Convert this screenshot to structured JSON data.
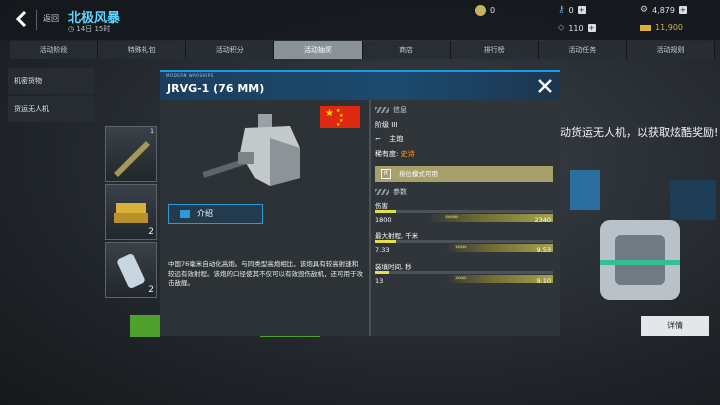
{
  "header": {
    "back_label": "返回",
    "event_title": "北极风暴",
    "event_timer": "14日 15时"
  },
  "resources": {
    "tokens": "0",
    "keys": "4,879",
    "fuel": "110",
    "gold": "11,900"
  },
  "tabs": [
    "活动阶段",
    "特殊礼包",
    "活动积分",
    "活动抽奖",
    "商店",
    "排行榜",
    "活动任务",
    "活动规则"
  ],
  "active_tab": "活动抽奖",
  "sidebar": {
    "items": [
      "机密货物",
      "货运无人机"
    ]
  },
  "background": {
    "promo_text": "动货运无人机，以获取炫酷奖励!",
    "details_button": "详情",
    "thumb_counts": [
      "1",
      "2",
      "2"
    ]
  },
  "modal": {
    "tag": "MODERN WARSHIPS",
    "title": "JRVG-1 (76 MM)",
    "intro_button": "介绍",
    "description": "中国76毫米自动化高炮。与同类型高炮相比，该炮具有较高射速和较远有效射程。该炮的口径使其不仅可以有效毁伤敌机，还可用于攻击敌舰。",
    "info": {
      "heading": "信息",
      "tier_label": "阶级",
      "tier_value": "III",
      "type_value": "主炮",
      "rarity_label": "稀有度:",
      "rarity_value": "史诗",
      "ranked_mode": "排位模式可用"
    },
    "params": {
      "heading": "参数",
      "stats": [
        {
          "label": "伤害",
          "current": "1800",
          "max": "2340",
          "fill": 0.12,
          "upgrade": 0.7
        },
        {
          "label": "最大射程, 千米",
          "current": "7.33",
          "max": "9.53",
          "fill": 0.12,
          "upgrade": 0.6
        },
        {
          "label": "装填时间, 秒",
          "current": "13",
          "max": "9.10",
          "fill": 0.08,
          "upgrade": 0.6
        }
      ]
    }
  },
  "colors": {
    "accent": "#1e9be0",
    "rarity_epic": "#ff9a2e",
    "stat_bar": "#e4e048",
    "event_title": "#5fd4ff"
  }
}
